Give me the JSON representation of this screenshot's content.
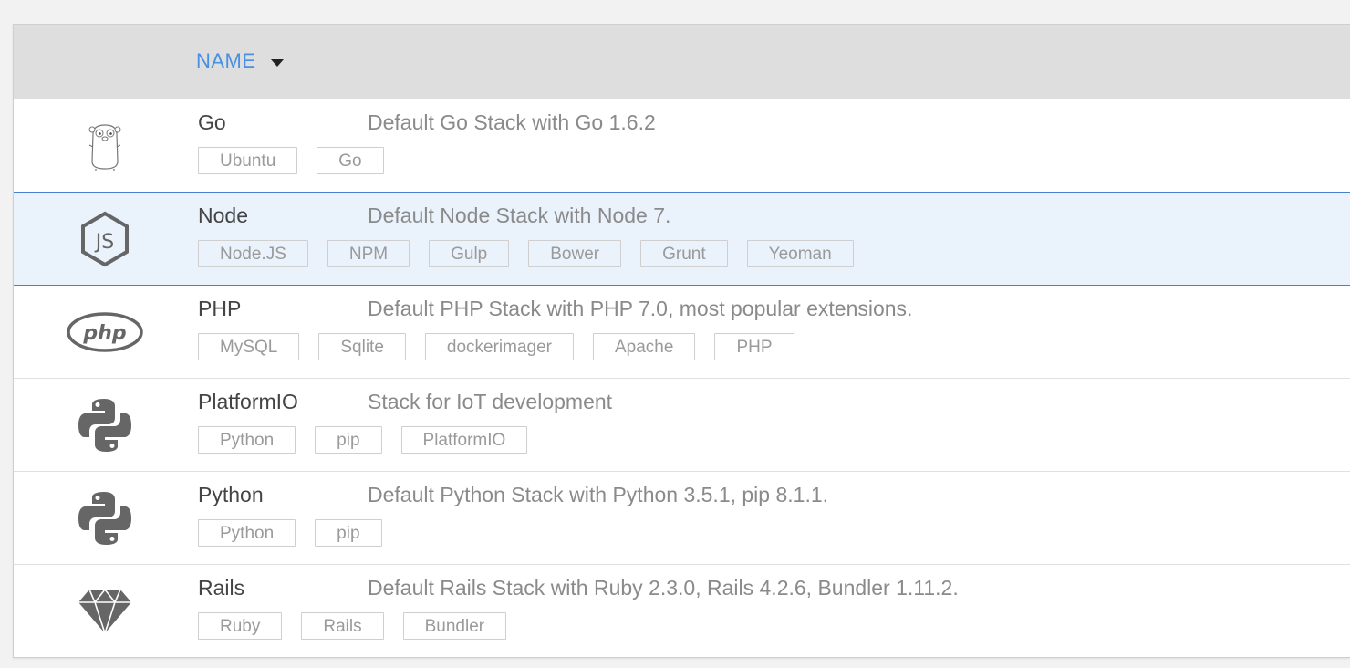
{
  "header": {
    "sort_label": "NAME"
  },
  "colors": {
    "accent": "#4a90e2",
    "selected_bg": "#eaf2fc",
    "selected_border": "#4a7fd0"
  },
  "stacks": [
    {
      "name": "Go",
      "description": "Default Go Stack with Go 1.6.2",
      "icon": "gopher-icon",
      "tags": [
        "Ubuntu",
        "Go"
      ]
    },
    {
      "name": "Node",
      "description": "Default Node Stack with Node 7.",
      "icon": "nodejs-icon",
      "selected": true,
      "tags": [
        "Node.JS",
        "NPM",
        "Gulp",
        "Bower",
        "Grunt",
        "Yeoman"
      ]
    },
    {
      "name": "PHP",
      "description": "Default PHP Stack with PHP 7.0, most popular extensions.",
      "icon": "php-icon",
      "tags": [
        "MySQL",
        "Sqlite",
        "dockerimager",
        "Apache",
        "PHP"
      ]
    },
    {
      "name": "PlatformIO",
      "description": "Stack for IoT development",
      "icon": "python-icon",
      "tags": [
        "Python",
        "pip",
        "PlatformIO"
      ]
    },
    {
      "name": "Python",
      "description": "Default Python Stack with Python 3.5.1, pip 8.1.1.",
      "icon": "python-icon",
      "tags": [
        "Python",
        "pip"
      ]
    },
    {
      "name": "Rails",
      "description": "Default Rails Stack with Ruby 2.3.0, Rails 4.2.6, Bundler 1.11.2.",
      "icon": "ruby-gem-icon",
      "tags": [
        "Ruby",
        "Rails",
        "Bundler"
      ]
    }
  ]
}
